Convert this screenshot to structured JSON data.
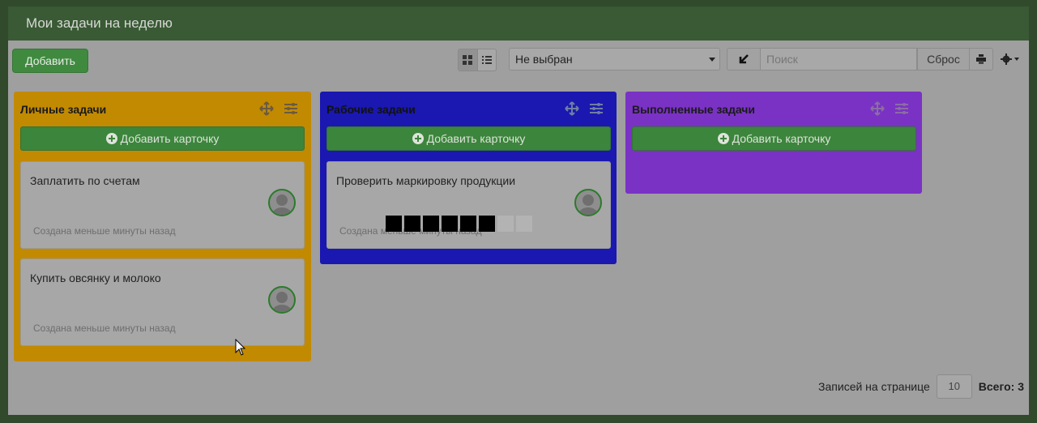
{
  "window": {
    "title": "Мои задачи на неделю"
  },
  "toolbar": {
    "add_label": "Добавить",
    "select_value": "Не выбран",
    "search_placeholder": "Поиск",
    "reset_label": "Сброс"
  },
  "columns": [
    {
      "title": "Личные задачи",
      "color": "#c28a00",
      "add_card_label": "Добавить карточку",
      "cards": [
        {
          "title": "Заплатить по счетам",
          "meta": "Создана меньше минуты назад"
        },
        {
          "title": "Купить овсянку и молоко",
          "meta": "Создана меньше минуты назад"
        }
      ]
    },
    {
      "title": "Рабочие задачи",
      "color": "#1a18b0",
      "add_card_label": "Добавить карточку",
      "cards": [
        {
          "title": "Проверить маркировку продукции",
          "meta": "Создана меньше минуты назад"
        }
      ]
    },
    {
      "title": "Выполненные задачи",
      "color": "#7a32c4",
      "add_card_label": "Добавить карточку",
      "cards": []
    }
  ],
  "footer": {
    "per_page_label": "Записей на странице",
    "per_page_value": "10",
    "total_label": "Всего: 3"
  },
  "icons": {
    "move": "move-icon",
    "settings": "sliders-icon",
    "plus": "plus-circle-icon",
    "avatar": "user-avatar-icon",
    "print": "print-icon",
    "gear": "gear-icon"
  }
}
